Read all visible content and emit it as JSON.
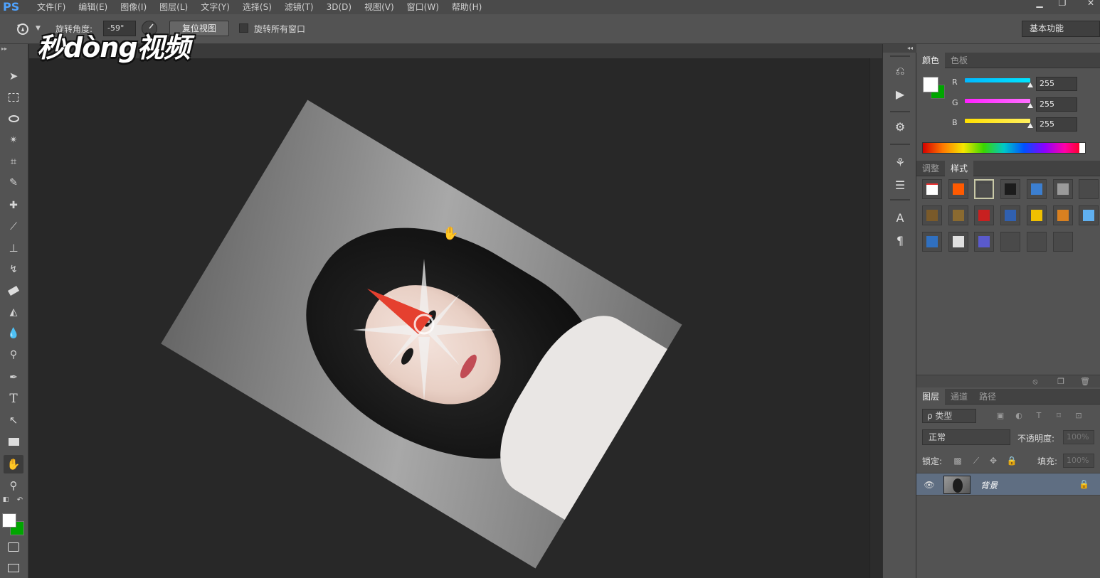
{
  "app": {
    "logo": "PS"
  },
  "menu": [
    "文件(F)",
    "编辑(E)",
    "图像(I)",
    "图层(L)",
    "文字(Y)",
    "选择(S)",
    "滤镜(T)",
    "3D(D)",
    "视图(V)",
    "窗口(W)",
    "帮助(H)"
  ],
  "options": {
    "rotate_angle_label": "旋转角度:",
    "rotate_angle_value": "-59°",
    "reset_view_label": "复位视图",
    "rotate_all_windows_label": "旋转所有窗口",
    "rotate_all_windows_checked": false,
    "workspace_label": "基本功能"
  },
  "watermark": "秒dòng视频",
  "toolbar": {
    "tools": [
      "move-tool-icon",
      "marquee-tool-icon",
      "lasso-tool-icon",
      "magic-wand-icon",
      "crop-tool-icon",
      "eyedropper-icon",
      "healing-brush-icon",
      "brush-tool-icon",
      "clone-stamp-icon",
      "history-brush-icon",
      "eraser-icon",
      "paint-bucket-icon",
      "blur-tool-icon",
      "dodge-tool-icon",
      "pen-tool-icon",
      "type-tool-icon",
      "path-select-icon",
      "rectangle-tool-icon",
      "rotate-view-icon",
      "zoom-tool-icon"
    ],
    "active_tool": "rotate-view-icon",
    "foreground_color": "#ffffff",
    "background_color": "#00a600"
  },
  "color_panel": {
    "tabs": [
      "颜色",
      "色板"
    ],
    "active_tab": "颜色",
    "channels": [
      {
        "label": "R",
        "value": "255",
        "color": "#00d4ff"
      },
      {
        "label": "G",
        "value": "255",
        "color": "#ff3cff"
      },
      {
        "label": "B",
        "value": "255",
        "color": "#ffee00"
      }
    ]
  },
  "styles_panel": {
    "tabs": [
      "调整",
      "样式"
    ],
    "active_tab": "样式",
    "selected_index": 2,
    "swatches": [
      "#ff2a2a",
      "#ff5a00",
      "#4d4d4d",
      "#1c1c1c",
      "#3c7fd0",
      "#9a9a9a",
      "#4a4a4a",
      "#7a5a2a",
      "#8a6a30",
      "#c82020",
      "#3060b0",
      "#f0c000",
      "#d88020",
      "#60b0f0",
      "#3070c0",
      "#e0e0e0",
      "#5a5acc",
      "#4a4a4a",
      "#4a4a4a",
      "#4a4a4a"
    ]
  },
  "layers_panel": {
    "tabs": [
      "图层",
      "通道",
      "路径"
    ],
    "active_tab": "图层",
    "filter_label": "ρ 类型",
    "blend_mode": "正常",
    "opacity_label": "不透明度:",
    "opacity_value": "100%",
    "lock_label": "锁定:",
    "fill_label": "填充:",
    "fill_value": "100%",
    "layers": [
      {
        "name": "背景",
        "visible": true,
        "locked": true
      }
    ]
  }
}
